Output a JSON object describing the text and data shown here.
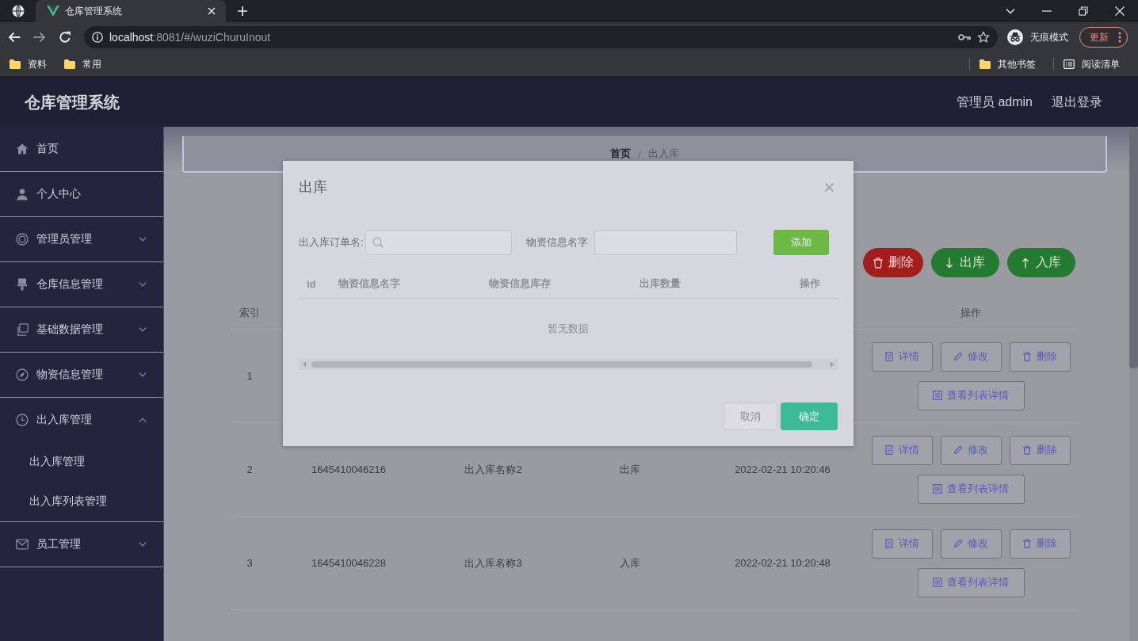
{
  "browser": {
    "tabs": [
      {
        "title": "仓库管理系统",
        "selected": true
      }
    ],
    "url": {
      "host": "localhost",
      "path": ":8081/#/wuziChuruInout"
    },
    "profile": "无痕模式",
    "update_button": "更新",
    "bookmarks": [
      {
        "label": "资料"
      },
      {
        "label": "常用"
      }
    ],
    "bookmarks_right": [
      {
        "label": "其他书签",
        "kind": "folder"
      },
      {
        "label": "阅读清单",
        "kind": "reading-list"
      }
    ]
  },
  "header": {
    "title": "仓库管理系统",
    "user": "管理员 admin",
    "logout": "退出登录"
  },
  "sidebar": {
    "items": [
      {
        "label": "首页",
        "kind": "link"
      },
      {
        "label": "个人中心",
        "kind": "link"
      },
      {
        "label": "管理员管理",
        "kind": "submenu",
        "expanded": false
      },
      {
        "label": "仓库信息管理",
        "kind": "submenu",
        "expanded": false
      },
      {
        "label": "基础数据管理",
        "kind": "submenu",
        "expanded": false
      },
      {
        "label": "物资信息管理",
        "kind": "submenu",
        "expanded": false
      },
      {
        "label": "出入库管理",
        "kind": "submenu",
        "expanded": true,
        "children": [
          {
            "label": "出入库管理"
          },
          {
            "label": "出入库列表管理"
          }
        ]
      },
      {
        "label": "员工管理",
        "kind": "submenu",
        "expanded": false
      }
    ]
  },
  "main": {
    "breadcrumb": {
      "items": [
        "首页",
        "出入库"
      ],
      "separator": "/"
    },
    "toolbar": [
      {
        "label": "删除",
        "kind": "danger"
      },
      {
        "label": "出库",
        "kind": "success"
      },
      {
        "label": "入库",
        "kind": "success"
      }
    ],
    "table": {
      "columns": [
        {
          "label": "索引",
          "kind": "index"
        },
        {
          "label": "操作",
          "kind": "actions"
        }
      ],
      "rows": [
        {
          "index": "1",
          "actions": [
            "详情",
            "修改",
            "删除",
            "查看列表详情"
          ]
        },
        {
          "index": "2",
          "order_no": "1645410046216",
          "name": "出入库名称2",
          "type": "出库",
          "time": "2022-02-21 10:20:46",
          "actions": [
            "详情",
            "修改",
            "删除",
            "查看列表详情"
          ]
        },
        {
          "index": "3",
          "order_no": "1645410046228",
          "name": "出入库名称3",
          "type": "入库",
          "time": "2022-02-21 10:20:48",
          "actions": [
            "详情",
            "修改",
            "删除",
            "查看列表详情"
          ]
        }
      ]
    }
  },
  "dialog": {
    "title": "出库",
    "filters": [
      {
        "label": "出入库订单名:",
        "kind": "search"
      },
      {
        "label": "物资信息名字",
        "kind": "text"
      }
    ],
    "add_button": "添加",
    "columns": [
      "id",
      "物资信息名字",
      "物资信息库存",
      "出库数量",
      "操作"
    ],
    "empty_text": "暂无数据",
    "buttons": [
      {
        "label": "取消",
        "kind": "default"
      },
      {
        "label": "确定",
        "kind": "primary"
      }
    ]
  }
}
